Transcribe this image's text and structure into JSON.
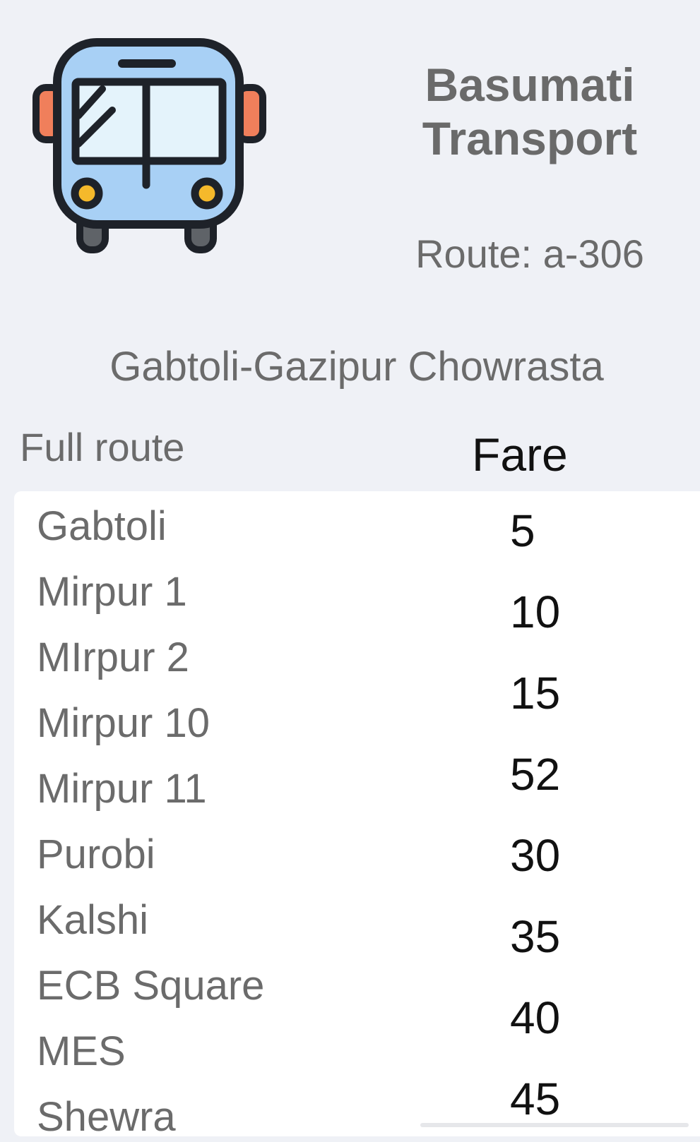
{
  "header": {
    "bus_icon": "bus-icon",
    "company_line1": "Basumati",
    "company_line2": "Transport",
    "route_id": "Route: a-306",
    "route_name": "Gabtoli-Gazipur Chowrasta"
  },
  "table": {
    "route_header": "Full route",
    "fare_header": "Fare",
    "stops": [
      "Gabtoli",
      "Mirpur 1",
      "MIrpur 2",
      "Mirpur 10",
      "Mirpur 11",
      "Purobi",
      "Kalshi",
      "ECB Square",
      "MES",
      "Shewra"
    ],
    "fares": [
      "5",
      "10",
      "15",
      "52",
      "30",
      "35",
      "40",
      "45"
    ]
  },
  "colors": {
    "background": "#eff1f6",
    "card": "#ffffff",
    "muted_text": "#6b6b6b",
    "fare_text": "#111111",
    "bus_body": "#a8d0f5",
    "bus_window": "#e4f3fb",
    "bus_outline": "#1e2229",
    "bus_mirror": "#f07f5b",
    "bus_headlight": "#f5b92b"
  }
}
